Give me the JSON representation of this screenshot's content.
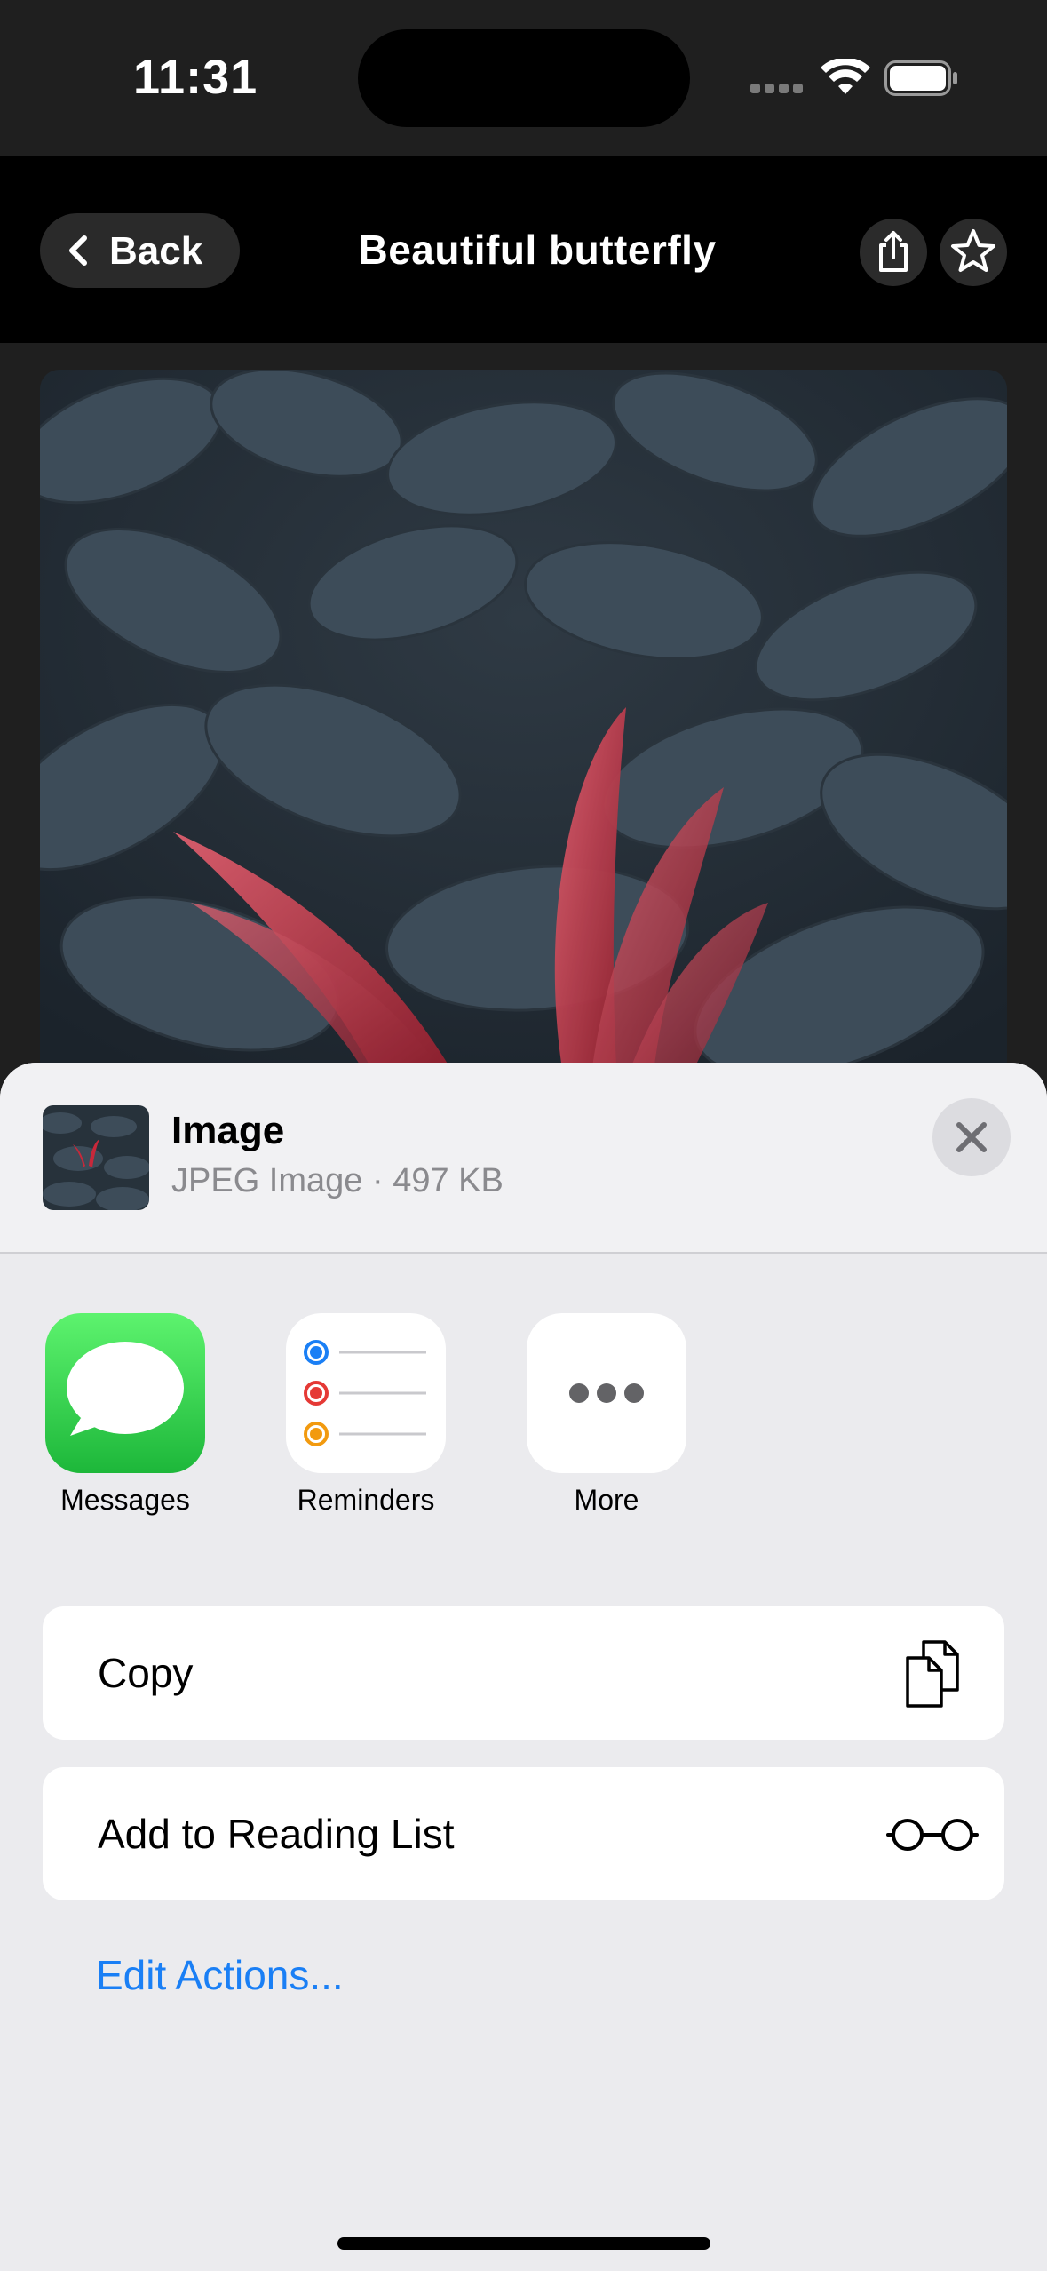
{
  "status_bar": {
    "time": "11:31"
  },
  "nav": {
    "back_label": "Back",
    "title": "Beautiful butterfly"
  },
  "sheet": {
    "file_name": "Image",
    "file_info": "JPEG Image · 497 KB",
    "apps": [
      {
        "label": "Messages",
        "icon": "messages-icon"
      },
      {
        "label": "Reminders",
        "icon": "reminders-icon"
      },
      {
        "label": "More",
        "icon": "more-icon"
      }
    ],
    "actions": [
      {
        "label": "Copy",
        "icon": "copy-icon"
      },
      {
        "label": "Add to Reading List",
        "icon": "reading-list-icon"
      }
    ],
    "edit_actions_label": "Edit Actions..."
  },
  "colors": {
    "accent": "#1a7ff5",
    "messages_green": "#34c759",
    "butterfly_red": "#c8283a",
    "leaf": "#3a4a58"
  }
}
